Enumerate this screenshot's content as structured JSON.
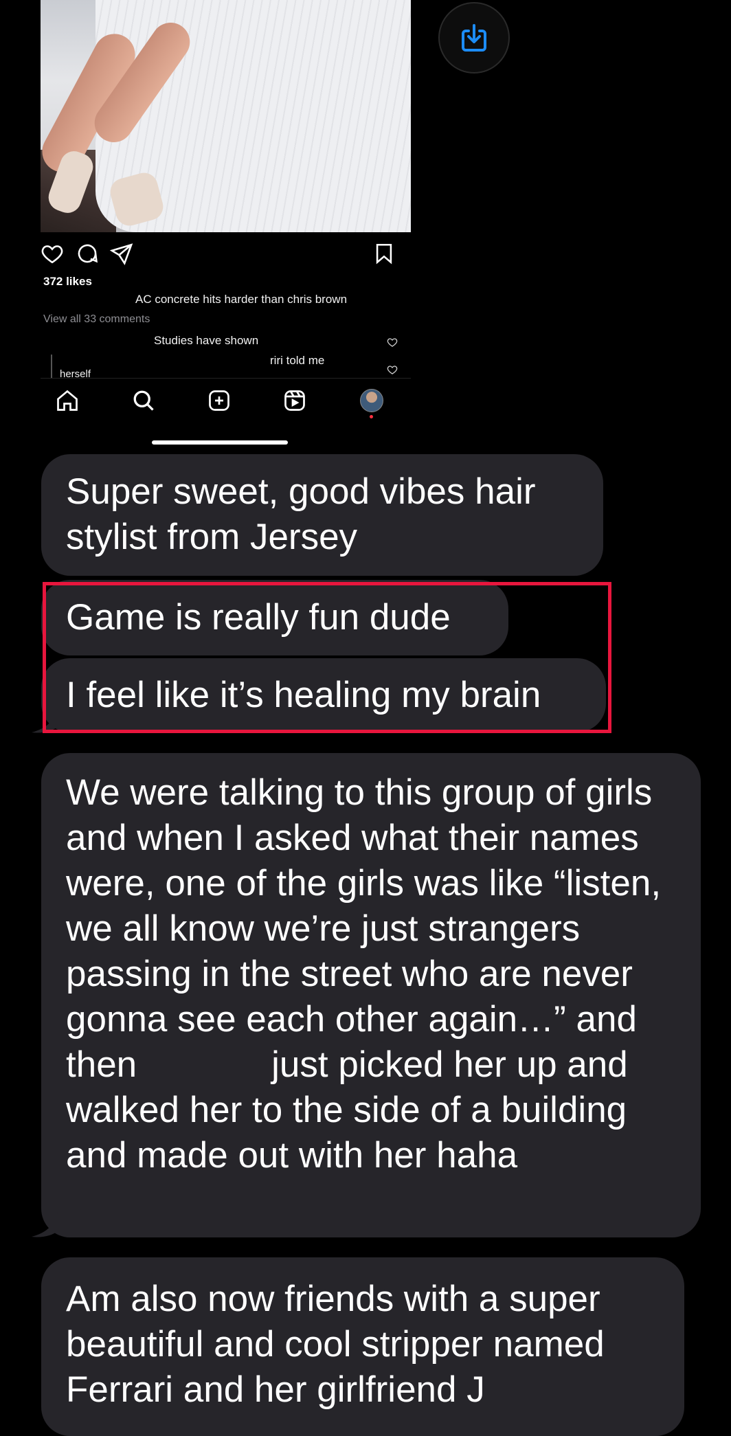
{
  "instagram_post": {
    "likes": "372 likes",
    "caption": "AC concrete hits harder than chris brown",
    "view_comments": "View all 33 comments",
    "comments": [
      "Studies have shown",
      "riri told me",
      "herself"
    ]
  },
  "messages": [
    "Super sweet, good vibes hair stylist from Jersey",
    "Game is really fun dude",
    "I feel like it’s healing my brain",
    "We were talking to this group of girls and when I asked what their names were, one of the girls was like “listen, we all know we’re just strangers passing in the street who are never gonna see each other again…” and then",
    "just picked her up and walked her to the side of a building and made out with her haha",
    "Am also now friends with a super beautiful and cool stripper named Ferrari and her girlfriend J"
  ],
  "colors": {
    "background": "#000000",
    "bubble": "#26252a",
    "highlight_border": "#e8163d",
    "share_icon": "#1c8cf5"
  },
  "icons": [
    "heart-icon",
    "comment-icon",
    "send-icon",
    "bookmark-icon",
    "home-icon",
    "search-icon",
    "create-icon",
    "reels-icon",
    "profile-avatar",
    "share-download-icon"
  ]
}
